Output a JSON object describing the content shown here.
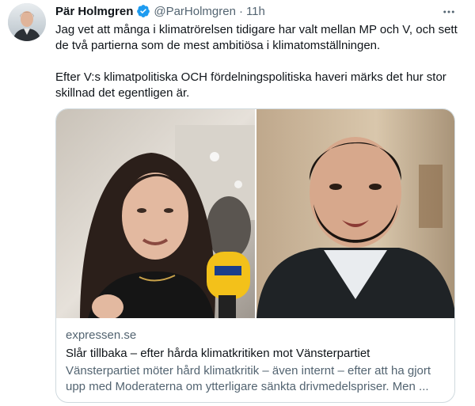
{
  "tweet": {
    "author_name": "Pär Holmgren",
    "handle": "@ParHolmgren",
    "separator": "·",
    "time": "11h",
    "paragraphs": [
      "Jag vet att många i klimatrörelsen tidigare har valt mellan MP och V, och sett de två partierna som de mest ambitiösa i klimatomställningen.",
      "Efter V:s klimatpolitiska OCH fördelningspolitiska haveri märks det hur stor skillnad det egentligen är."
    ],
    "more_icon": "more-dots-icon",
    "verified_icon": "verified-badge-icon"
  },
  "card": {
    "domain": "expressen.se",
    "title": "Slår tillbaka – efter hårda klimatkritiken mot Vänsterpartiet",
    "description": "Vänsterpartiet möter hård klimatkritik – även internt – efter att ha gjort upp med Moderaterna om ytterligare sänkta drivmedelspriser. Men ..."
  },
  "colors": {
    "accent": "#1d9bf0",
    "text": "#0f1419",
    "secondary": "#536471",
    "border": "#cfd9de"
  }
}
